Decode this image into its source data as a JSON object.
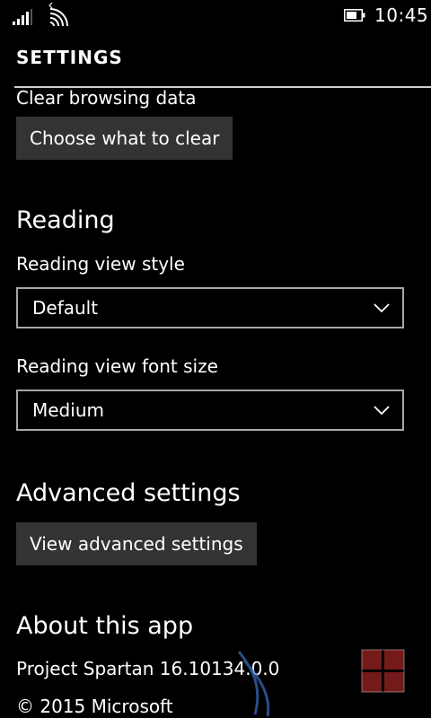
{
  "status_bar": {
    "time": "10:45",
    "icons": [
      "signal-icon",
      "wifi-icon",
      "battery-icon"
    ]
  },
  "header": {
    "title": "SETTINGS"
  },
  "clear_browsing": {
    "label": "Clear browsing data",
    "button_label": "Choose what to clear"
  },
  "reading": {
    "heading": "Reading",
    "view_style_label": "Reading view style",
    "view_style_value": "Default",
    "font_size_label": "Reading view font size",
    "font_size_value": "Medium"
  },
  "advanced": {
    "heading": "Advanced settings",
    "button_label": "View advanced settings"
  },
  "about": {
    "heading": "About this app",
    "version": "Project Spartan 16.10134.0.0",
    "copyright": "© 2015 Microsoft"
  },
  "colors": {
    "background": "#000000",
    "button": "#333333",
    "border": "#a8a8a8"
  }
}
